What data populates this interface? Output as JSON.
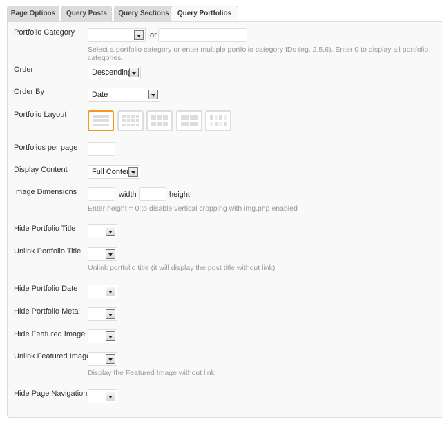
{
  "tabs": [
    {
      "label": "Page Options",
      "active": false
    },
    {
      "label": "Query Posts",
      "active": false
    },
    {
      "label": "Query Sections",
      "active": false
    },
    {
      "label": "Query Portfolios",
      "active": true
    }
  ],
  "fields": {
    "portfolio_category": {
      "label": "Portfolio Category",
      "value": "",
      "or": "or",
      "ids_value": "",
      "help": "Select a portfolio category or enter multiple portfolio category IDs (eg. 2,5,6). Enter 0 to display all portfolio categories."
    },
    "order": {
      "label": "Order",
      "value": "Descending"
    },
    "order_by": {
      "label": "Order By",
      "value": "Date"
    },
    "portfolio_layout": {
      "label": "Portfolio Layout",
      "options": [
        "list-post",
        "grid4",
        "grid3",
        "grid2",
        "grid2-thumb"
      ],
      "selected": "list-post"
    },
    "per_page": {
      "label": "Portfolios per page",
      "value": ""
    },
    "display_content": {
      "label": "Display Content",
      "value": "Full Content"
    },
    "image_dimensions": {
      "label": "Image Dimensions",
      "width_label": "width",
      "height_label": "height",
      "help": "Enter height = 0 to disable vertical cropping with img.php enabled"
    },
    "hide_title": {
      "label": "Hide Portfolio Title"
    },
    "unlink_title": {
      "label": "Unlink Portfolio Title",
      "help": "Unlink portfolio title (it will display the post title without link)"
    },
    "hide_date": {
      "label": "Hide Portfolio Date"
    },
    "hide_meta": {
      "label": "Hide Portfolio Meta"
    },
    "hide_featured": {
      "label": "Hide Featured Image"
    },
    "unlink_featured": {
      "label": "Unlink Featured Image",
      "help": "Display the Featured Image without link"
    },
    "hide_nav": {
      "label": "Hide Page Navigation"
    }
  },
  "colors": {
    "accent": "#f29a1c"
  }
}
